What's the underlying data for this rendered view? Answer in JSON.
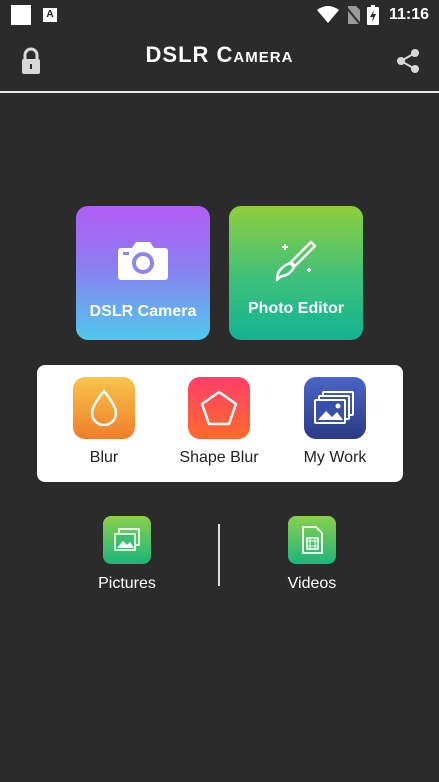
{
  "status_bar": {
    "time": "11:16",
    "notification_icons": [
      "square-icon",
      "a-icon"
    ],
    "system_icons": [
      "wifi-icon",
      "no-sim-icon",
      "battery-charging-icon"
    ]
  },
  "header": {
    "title": "DSLR Camera",
    "left_icon": "lock-icon",
    "right_icon": "share-icon"
  },
  "tiles": [
    {
      "label": "DSLR Camera",
      "icon": "camera-icon"
    },
    {
      "label": "Photo Editor",
      "icon": "brush-icon"
    }
  ],
  "tools": [
    {
      "label": "Blur",
      "icon": "drop-icon"
    },
    {
      "label": "Shape Blur",
      "icon": "pentagon-icon"
    },
    {
      "label": "My Work",
      "icon": "gallery-icon"
    }
  ],
  "bottom": [
    {
      "label": "Pictures",
      "icon": "picture-icon"
    },
    {
      "label": "Videos",
      "icon": "video-file-icon"
    }
  ],
  "colors": {
    "background": "#2b2b2b",
    "camera_tile": [
      "#b25cf6",
      "#4fc9ee"
    ],
    "editor_tile": [
      "#8fcf3c",
      "#12b392"
    ],
    "blur": [
      "#f8c54a",
      "#f07d2a"
    ],
    "shape_blur": [
      "#ff3f6a",
      "#ff6a2c"
    ],
    "my_work": [
      "#4a64c8",
      "#2b3b86"
    ]
  }
}
